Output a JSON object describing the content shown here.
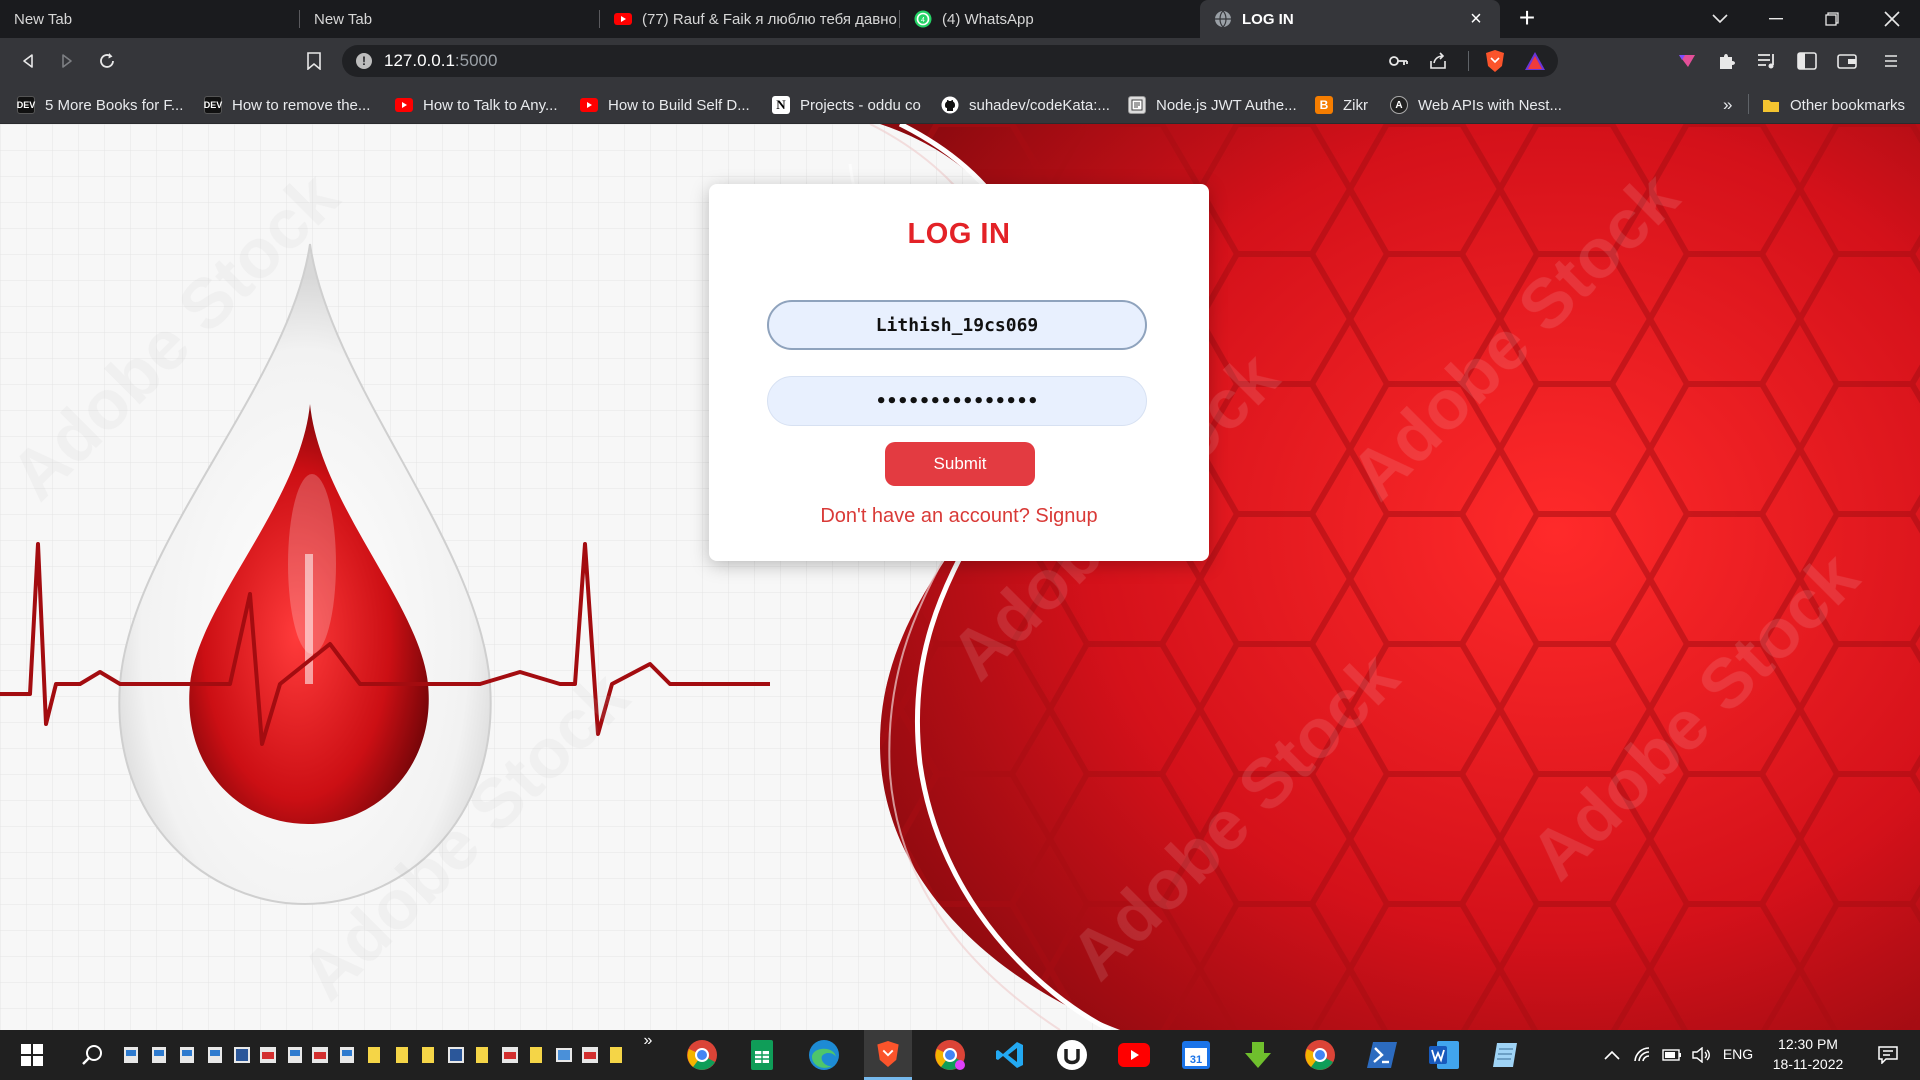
{
  "browser": {
    "tabs": [
      {
        "title": "New Tab",
        "icon": "none"
      },
      {
        "title": "New Tab",
        "icon": "none"
      },
      {
        "title": "(77) Rauf & Faik я люблю тебя давно",
        "icon": "youtube-icon"
      },
      {
        "title": "(4) WhatsApp",
        "icon": "whatsapp-icon"
      },
      {
        "title": "LOG IN",
        "icon": "globe-icon",
        "active": true
      }
    ],
    "address": {
      "host": "127.0.0.1",
      "port": ":5000"
    },
    "bookmarks": [
      {
        "label": "5 More Books for F...",
        "icon": "dev-icon"
      },
      {
        "label": "How to remove the...",
        "icon": "dev-icon"
      },
      {
        "label": "How to Talk to Any...",
        "icon": "youtube-icon"
      },
      {
        "label": "How to Build Self D...",
        "icon": "youtube-icon"
      },
      {
        "label": "Projects - oddu co",
        "icon": "notion-icon"
      },
      {
        "label": "suhadev/codeKata:...",
        "icon": "github-icon"
      },
      {
        "label": "Node.js JWT Authe...",
        "icon": "page-icon"
      },
      {
        "label": "Zikr",
        "icon": "blogger-icon"
      },
      {
        "label": "Web APIs with Nest...",
        "icon": "a-icon"
      }
    ],
    "bookmarks_overflow": "»",
    "other_bookmarks": "Other bookmarks",
    "colors": {
      "tabstrip": "#1a1b1e",
      "toolbar": "#35363a",
      "omnibox": "#202124"
    }
  },
  "login": {
    "title": "LOG IN",
    "username": "Lithish_19cs069",
    "password": "•••••••••••••••",
    "submit_label": "Submit",
    "signup_text": "Don't have an account? Signup",
    "colors": {
      "accent": "#e32227",
      "button": "#e33b41",
      "field": "#e8f0fe"
    }
  },
  "taskbar": {
    "time": "12:30 PM",
    "date": "18-11-2022",
    "language": "ENG",
    "overflow": "»"
  }
}
